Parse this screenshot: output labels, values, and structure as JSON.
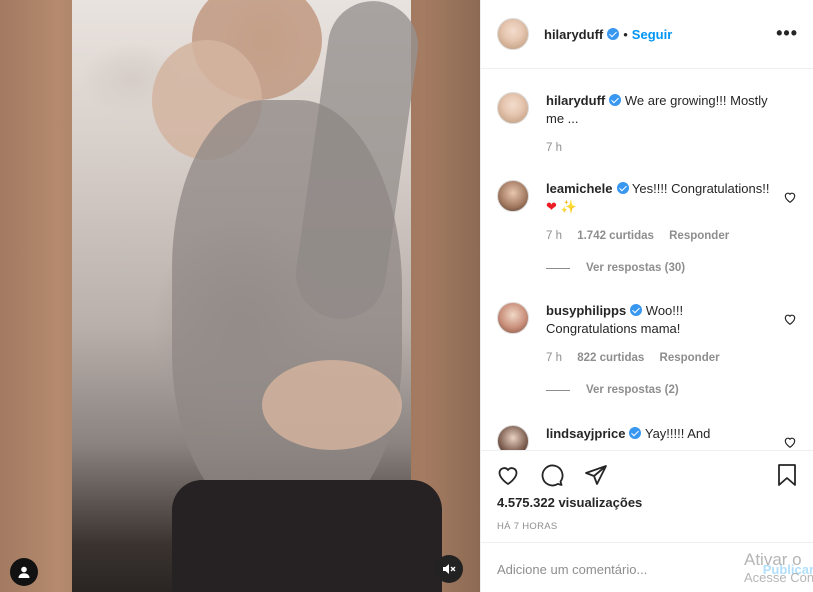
{
  "post": {
    "username": "hilaryduff",
    "separator": "•",
    "follow_label": "Seguir",
    "more_label": "•••"
  },
  "caption": {
    "username": "hilaryduff",
    "text": "We are growing!!! Mostly me ...",
    "time": "7 h"
  },
  "comments": [
    {
      "username": "leamichele",
      "text": "Yes!!!! Congratulations!!",
      "emoji": "❤ ✨",
      "time": "7 h",
      "likes": "1.742 curtidas",
      "reply_label": "Responder",
      "view_replies": "Ver respostas (30)"
    },
    {
      "username": "busyphilipps",
      "text": "Woo!!! Congratulations mama!",
      "time": "7 h",
      "likes": "822 curtidas",
      "reply_label": "Responder",
      "view_replies": "Ver respostas (2)"
    },
    {
      "username": "lindsayjprice",
      "text": "Yay!!!!! And"
    }
  ],
  "stats": {
    "views": "4.575.322 visualizações",
    "posted": "HÁ 7 HORAS"
  },
  "add_comment": {
    "placeholder": "Adicione um comentário...",
    "publish_label": "Publicar"
  },
  "overlay": {
    "line1": "Ativar o",
    "line2": "Acesse Con"
  },
  "colors": {
    "link_blue": "#0095f6",
    "verified_blue": "#3897f0",
    "muted_text": "#8e8e8e",
    "heart_red": "#ed1c24"
  },
  "icons": [
    "user-icon",
    "mute-icon",
    "heart-icon",
    "comment-icon",
    "share-icon",
    "bookmark-icon",
    "more-icon",
    "verified-icon"
  ]
}
